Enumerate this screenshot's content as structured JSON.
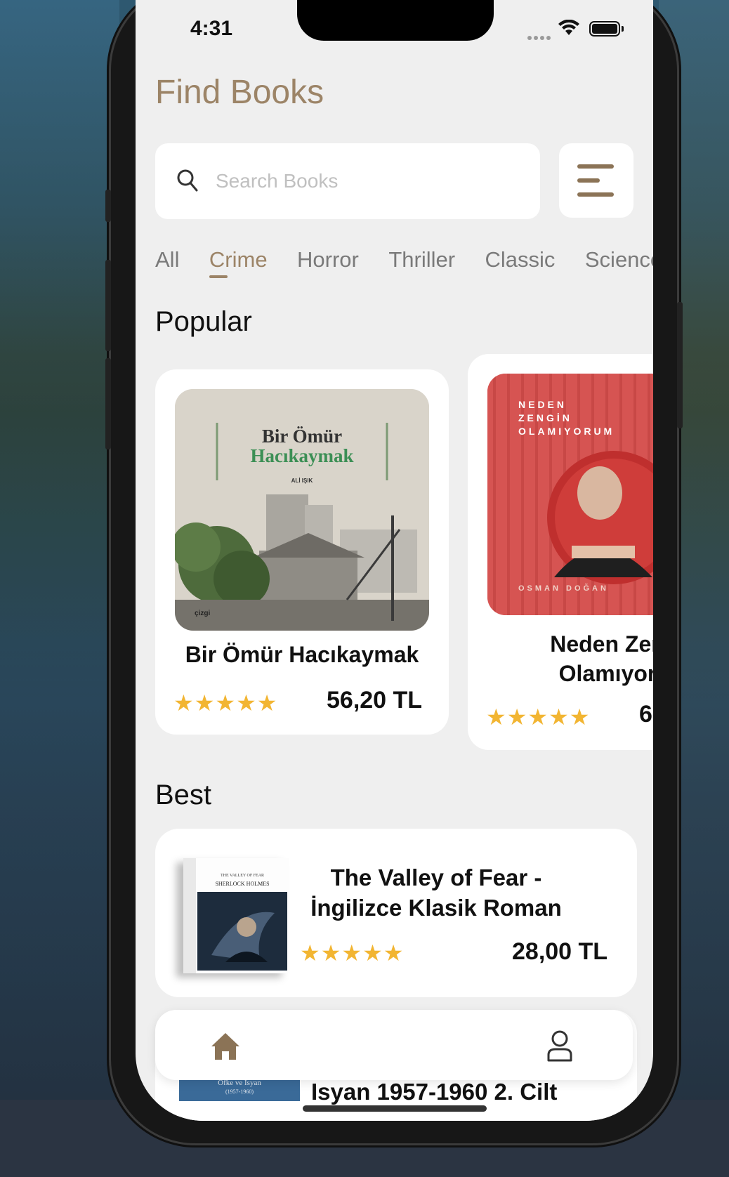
{
  "status": {
    "time": "4:31"
  },
  "header": {
    "title": "Find Books"
  },
  "search": {
    "placeholder": "Search Books",
    "value": ""
  },
  "categories": [
    {
      "label": "All",
      "active": false
    },
    {
      "label": "Crime",
      "active": true
    },
    {
      "label": "Horror",
      "active": false
    },
    {
      "label": "Thriller",
      "active": false
    },
    {
      "label": "Classic",
      "active": false
    },
    {
      "label": "Science",
      "active": false
    }
  ],
  "popular": {
    "title": "Popular",
    "books": [
      {
        "name": "Bir Ömür Hacıkaymak",
        "rating": "★★★★★",
        "price": "56,20 TL",
        "cover": {
          "title_line1": "Bir Ömür",
          "title_line2": "Hacıkaymak",
          "author": "ALİ IŞIK",
          "publisher": "çizgi"
        }
      },
      {
        "name": "Neden Zengin Olamıyorum",
        "rating": "★★★★★",
        "price": "6",
        "cover": {
          "title_line1": "NEDEN",
          "title_line2": "ZENGİN",
          "title_line3": "OLAMIYORUM",
          "author": "OSMAN DOĞAN"
        }
      }
    ]
  },
  "best": {
    "title": "Best",
    "books": [
      {
        "name": "The Valley of Fear - İngilizce Klasik Roman",
        "rating": "★★★★★",
        "price": "28,00 TL",
        "cover": {
          "series": "THE VALLEY OF FEAR",
          "subtitle": "SHERLOCK HOLMES"
        }
      },
      {
        "name": "Isyan 1957-1960 2. Cilt",
        "cover": {
          "title": "Öfke ve İsyan",
          "years": "(1957-1960)"
        }
      }
    ]
  },
  "nav": {
    "items": [
      "home-icon",
      "profile-icon"
    ]
  },
  "colors": {
    "accent": "#9c8467",
    "star": "#f2b532",
    "background": "#efefef"
  }
}
